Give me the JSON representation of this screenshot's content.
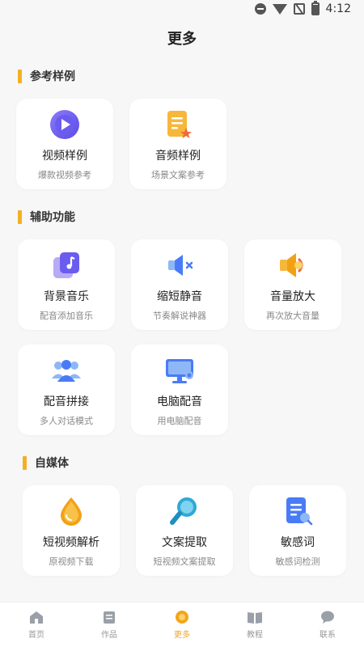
{
  "status": {
    "time": "4:12"
  },
  "page": {
    "title": "更多"
  },
  "sections": [
    {
      "title": "参考样例",
      "items": [
        {
          "title": "视频样例",
          "subtitle": "爆款视频参考",
          "icon": "play-icon"
        },
        {
          "title": "音频样例",
          "subtitle": "场景文案参考",
          "icon": "document-star-icon"
        }
      ]
    },
    {
      "title": "辅助功能",
      "items": [
        {
          "title": "背景音乐",
          "subtitle": "配音添加音乐",
          "icon": "music-note-icon"
        },
        {
          "title": "缩短静音",
          "subtitle": "节奏解说神器",
          "icon": "mute-speaker-icon"
        },
        {
          "title": "音量放大",
          "subtitle": "再次放大音量",
          "icon": "volume-up-icon"
        },
        {
          "title": "配音拼接",
          "subtitle": "多人对话模式",
          "icon": "group-icon"
        },
        {
          "title": "电脑配音",
          "subtitle": "用电脑配音",
          "icon": "computer-icon"
        }
      ]
    },
    {
      "title": "自媒体",
      "items": [
        {
          "title": "短视频解析",
          "subtitle": "原视频下载",
          "icon": "drop-icon"
        },
        {
          "title": "文案提取",
          "subtitle": "短视频文案提取",
          "icon": "search-icon"
        },
        {
          "title": "敏感词",
          "subtitle": "敏感词检测",
          "icon": "document-search-icon"
        }
      ]
    }
  ],
  "nav": [
    {
      "label": "首页",
      "icon": "home-icon"
    },
    {
      "label": "作品",
      "icon": "folder-icon"
    },
    {
      "label": "更多",
      "icon": "more-icon",
      "active": true
    },
    {
      "label": "教程",
      "icon": "book-icon"
    },
    {
      "label": "联系",
      "icon": "chat-icon"
    }
  ],
  "colors": {
    "accent": "#f4b023",
    "active_nav": "#f4a51c",
    "blue": "#4a7bf7",
    "purple": "#6b5cf0"
  }
}
